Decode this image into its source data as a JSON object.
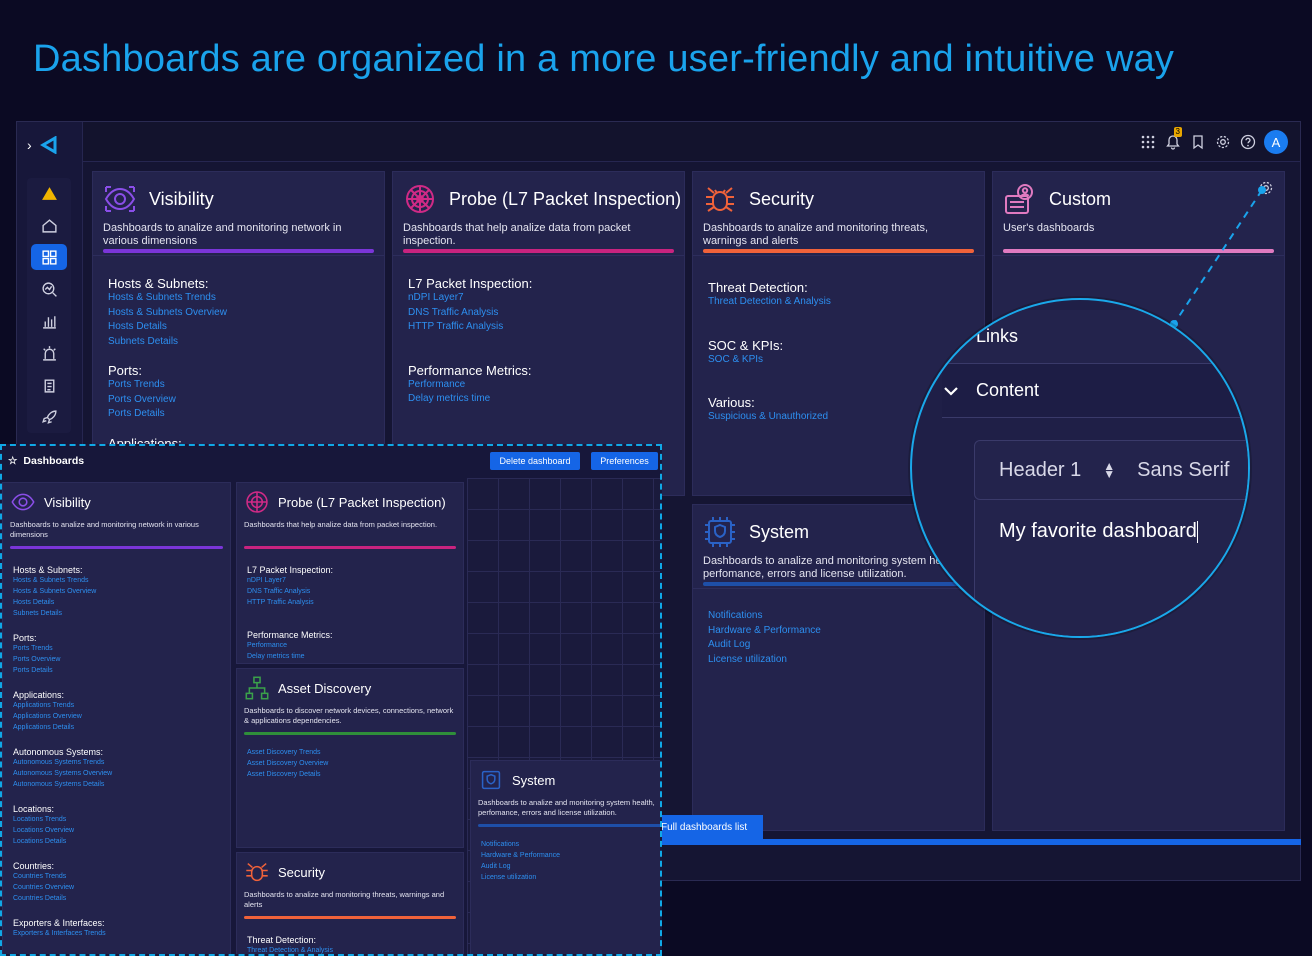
{
  "headline": "Dashboards are organized in a more user-friendly and intuitive way",
  "topbar": {
    "notifications_count": "3",
    "avatar_letter": "A"
  },
  "main_cards": {
    "visibility": {
      "title": "Visibility",
      "desc": "Dashboards to analize and monitoring network in various dimensions",
      "sections": [
        {
          "name": "Hosts & Subnets:",
          "links": [
            "Hosts & Subnets Trends",
            "Hosts & Subnets Overview",
            "Hosts Details",
            "Subnets Details"
          ]
        },
        {
          "name": "Ports:",
          "links": [
            "Ports Trends",
            "Ports Overview",
            "Ports Details"
          ]
        },
        {
          "name": "Applications:"
        }
      ]
    },
    "probe": {
      "title": "Probe (L7 Packet Inspection)",
      "desc": "Dashboards that help analize data from packet inspection.",
      "sections": [
        {
          "name": "L7 Packet Inspection:",
          "links": [
            "nDPI Layer7",
            "DNS Traffic Analysis",
            "HTTP Traffic Analysis"
          ]
        },
        {
          "name": "Performance Metrics:",
          "links": [
            "Performance",
            "Delay metrics time"
          ]
        }
      ]
    },
    "security": {
      "title": "Security",
      "desc": "Dashboards to analize and monitoring threats, warnings and alerts",
      "sections": [
        {
          "name": "Threat Detection:",
          "links": [
            "Threat Detection & Analysis"
          ]
        },
        {
          "name": "SOC & KPIs:",
          "links": [
            "SOC & KPIs"
          ]
        },
        {
          "name": "Various:",
          "links": [
            "Suspicious & Unauthorized"
          ]
        }
      ]
    },
    "custom": {
      "title": "Custom",
      "desc": "User's dashboards"
    },
    "system": {
      "title": "System",
      "desc": "Dashboards to analize and monitoring system health, perfomance, errors and license utilization.",
      "links": [
        "Notifications",
        "Hardware & Performance",
        "Audit Log",
        "License utilization"
      ]
    }
  },
  "lower": {
    "title": "Dashboards",
    "delete_btn": "Delete dashboard",
    "prefs_btn": "Preferences",
    "visibility": {
      "title": "Visibility",
      "desc": "Dashboards to analize and monitoring network in various dimensions",
      "sections": [
        {
          "name": "Hosts & Subnets:",
          "links": [
            "Hosts & Subnets Trends",
            "Hosts & Subnets Overview",
            "Hosts Details",
            "Subnets Details"
          ]
        },
        {
          "name": "Ports:",
          "links": [
            "Ports Trends",
            "Ports Overview",
            "Ports Details"
          ]
        },
        {
          "name": "Applications:",
          "links": [
            "Applications Trends",
            "Applications Overview",
            "Applications Details"
          ]
        },
        {
          "name": "Autonomous Systems:",
          "links": [
            "Autonomous Systems Trends",
            "Autonomous Systems Overview",
            "Autonomous Systems Details"
          ]
        },
        {
          "name": "Locations:",
          "links": [
            "Locations Trends",
            "Locations Overview",
            "Locations Details"
          ]
        },
        {
          "name": "Countries:",
          "links": [
            "Countries Trends",
            "Countries Overview",
            "Countries Details"
          ]
        },
        {
          "name": "Exporters & Interfaces:",
          "links": [
            "Exporters & Interfaces Trends"
          ]
        }
      ]
    },
    "probe": {
      "title": "Probe (L7 Packet Inspection)",
      "desc": "Dashboards that help analize data from packet inspection.",
      "sections": [
        {
          "name": "L7 Packet Inspection:",
          "links": [
            "nDPI Layer7",
            "DNS Traffic Analysis",
            "HTTP Traffic Analysis"
          ]
        },
        {
          "name": "Performance Metrics:",
          "links": [
            "Performance",
            "Delay metrics time"
          ]
        }
      ]
    },
    "asset": {
      "title": "Asset Discovery",
      "desc": "Dashboards to discover network devices, connections, network & applications dependencies.",
      "links": [
        "Asset Discovery Trends",
        "Asset Discovery Overview",
        "Asset Discovery Details"
      ]
    },
    "security": {
      "title": "Security",
      "desc": "Dashboards to analize and monitoring threats, warnings and alerts",
      "sections": [
        {
          "name": "Threat Detection:",
          "links": [
            "Threat Detection & Analysis"
          ]
        }
      ]
    },
    "system": {
      "title": "System",
      "desc": "Dashboards to analize and monitoring system health, perfomance, errors and license utilization.",
      "links": [
        "Notifications",
        "Hardware & Performance",
        "Audit Log",
        "License utilization"
      ]
    }
  },
  "full_list_btn": "Full dashboards list",
  "magnifier": {
    "links_label": "Links",
    "content_label": "Content",
    "header_select": "Header 1",
    "font_select": "Sans Serif",
    "text_value": "My favorite dashboard"
  },
  "colors": {
    "visibility": "#7a35d8",
    "probe": "#c8237f",
    "security": "#f0623a",
    "custom": "#e07ac0",
    "system": "#1e4fa8",
    "asset": "#2f8f3a",
    "accent": "#1aa3ec"
  }
}
